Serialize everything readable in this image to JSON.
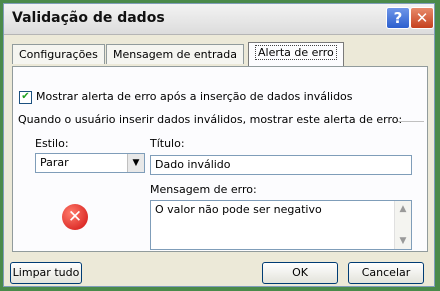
{
  "window": {
    "title": "Validação de dados",
    "help": "?",
    "close": "✕"
  },
  "tabs": [
    {
      "label": "Configurações",
      "active": false
    },
    {
      "label": "Mensagem de entrada",
      "active": false
    },
    {
      "label": "Alerta de erro",
      "active": true
    }
  ],
  "alert": {
    "show_checkbox_label": "Mostrar alerta de erro após a inserção de dados inválidos",
    "show_checked": true,
    "instruction": "Quando o usuário inserir dados inválidos, mostrar este alerta de erro:",
    "style_label": "Estilo:",
    "style_value": "Parar",
    "title_label": "Título:",
    "title_value": "Dado inválido",
    "message_label": "Mensagem de erro:",
    "message_value": "O valor não pode ser negativo",
    "icon": "error-stop-icon"
  },
  "buttons": {
    "clear_all": "Limpar tudo",
    "ok": "OK",
    "cancel": "Cancelar"
  }
}
